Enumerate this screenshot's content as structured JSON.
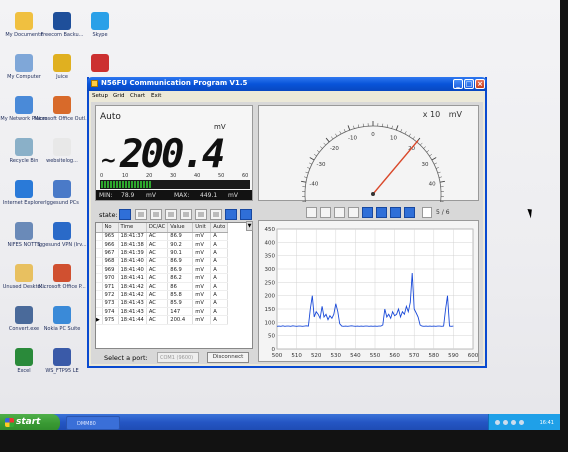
{
  "desktop": {
    "icons": [
      {
        "label": "My Documents",
        "color": "#f0c040"
      },
      {
        "label": "Freecom Backu...",
        "color": "#1e4f9a"
      },
      {
        "label": "Skype",
        "color": "#2aa0e8"
      },
      {
        "label": "My Computer",
        "color": "#7fa7d8"
      },
      {
        "label": "Juice",
        "color": "#e0b020"
      },
      {
        "label": "",
        "color": "#cc3030"
      },
      {
        "label": "My Network Places",
        "color": "#4a8ad8"
      },
      {
        "label": "Microsoft Office Outl...",
        "color": "#d86a2a"
      },
      {
        "label": "Recycle Bin",
        "color": "#8ab0c8"
      },
      {
        "label": "websitelog...",
        "color": "#e8e8e8"
      },
      {
        "label": "Internet Explorer",
        "color": "#2a7ad8"
      },
      {
        "label": "Iggesund PCs",
        "color": "#4a7ac8"
      },
      {
        "label": "NIFES NOTTS",
        "color": "#6a8ab8"
      },
      {
        "label": "Iggesund VPN (Irv...",
        "color": "#2a6ac8"
      },
      {
        "label": "Unused Deskto...",
        "color": "#e8c060"
      },
      {
        "label": "Microsoft Office P...",
        "color": "#d05030"
      },
      {
        "label": "Convert.exe",
        "color": "#4a6a9a"
      },
      {
        "label": "Nokia PC Suite",
        "color": "#3a8ad8"
      },
      {
        "label": "Excel",
        "color": "#2a8a3a"
      },
      {
        "label": "WS_FTP95 LE",
        "color": "#3a5aa8"
      }
    ]
  },
  "taskbar": {
    "start_label": "start",
    "task_label": "DMM80",
    "clock": "16:41"
  },
  "window": {
    "title": "N56FU Communication Program V1.5",
    "controls": {
      "minimize": "_",
      "maximize": "□",
      "close": "×"
    },
    "menu": [
      "Setup",
      "Grid",
      "Chart",
      "Exit"
    ]
  },
  "meter": {
    "mode": "Auto",
    "unit": "mV",
    "ac_symbol": "~",
    "reading": "200.4",
    "scale_ticks": [
      "0",
      "10",
      "20",
      "30",
      "40",
      "50",
      "60"
    ],
    "bar_fraction": 0.34,
    "min_label": "MIN:",
    "min_value": "78.9",
    "min_unit": "mV",
    "max_label": "MAX:",
    "max_value": "449.1",
    "max_unit": "mV"
  },
  "state_label": "state:",
  "table": {
    "headers": [
      "",
      "No",
      "Time",
      "DC/AC",
      "Value",
      "Unit",
      "Auto"
    ],
    "rows": [
      [
        "965",
        "18:41:37",
        "AC",
        "86.9",
        "mV",
        "A"
      ],
      [
        "966",
        "18:41:38",
        "AC",
        "90.2",
        "mV",
        "A"
      ],
      [
        "967",
        "18:41:39",
        "AC",
        "90.1",
        "mV",
        "A"
      ],
      [
        "968",
        "18:41:40",
        "AC",
        "86.9",
        "mV",
        "A"
      ],
      [
        "969",
        "18:41:40",
        "AC",
        "86.9",
        "mV",
        "A"
      ],
      [
        "970",
        "18:41:41",
        "AC",
        "86.2",
        "mV",
        "A"
      ],
      [
        "971",
        "18:41:42",
        "AC",
        "86",
        "mV",
        "A"
      ],
      [
        "972",
        "18:41:42",
        "AC",
        "85.8",
        "mV",
        "A"
      ],
      [
        "973",
        "18:41:43",
        "AC",
        "85.9",
        "mV",
        "A"
      ],
      [
        "974",
        "18:41:43",
        "AC",
        "147",
        "mV",
        "A"
      ],
      [
        "975",
        "18:41:44",
        "AC",
        "200.4",
        "mV",
        "A"
      ]
    ],
    "current_row_index": 10
  },
  "port": {
    "label": "Select a port:",
    "selected": "COM1 (9600)",
    "disconnect_label": "Disconnect"
  },
  "gauge": {
    "range_multiplier": "x 10",
    "unit": "mV",
    "ticks": [
      "-60",
      "-50",
      "-40",
      "-30",
      "-20",
      "-10",
      "0",
      "10",
      "20",
      "30",
      "40",
      "50",
      "60"
    ],
    "value": 20.04,
    "min": -60,
    "max": 60
  },
  "chart_toolbar": {
    "page_current": "5",
    "page_total": "6",
    "page_sep": "/"
  },
  "chart_data": {
    "type": "line",
    "title": "",
    "xlabel": "",
    "ylabel": "",
    "xlim": [
      500,
      600
    ],
    "ylim": [
      0,
      450
    ],
    "x_ticks": [
      500,
      510,
      520,
      530,
      540,
      550,
      560,
      570,
      580,
      590,
      600
    ],
    "y_ticks": [
      0,
      50,
      100,
      150,
      200,
      250,
      300,
      350,
      400,
      450
    ],
    "grid": true,
    "series": [
      {
        "color": "#1a4ad8",
        "x": [
          500,
          501,
          502,
          503,
          504,
          505,
          506,
          507,
          508,
          509,
          510,
          511,
          512,
          513,
          514,
          515,
          516,
          517,
          518,
          519,
          520,
          521,
          522,
          523,
          524,
          525,
          526,
          527,
          528,
          529,
          530,
          531,
          532,
          533,
          534,
          535,
          536,
          537,
          538,
          539,
          540,
          541,
          542,
          543,
          544,
          545,
          546,
          547,
          548,
          549,
          550,
          551,
          552,
          553,
          554,
          555,
          556,
          557,
          558,
          559,
          560,
          561,
          562,
          563,
          564,
          565,
          566,
          567,
          568,
          569,
          570,
          571,
          572,
          573,
          574,
          575,
          576,
          577,
          578,
          579,
          580,
          581,
          582,
          583,
          584,
          585,
          586,
          587,
          588,
          589,
          590
        ],
        "y": [
          85,
          86,
          85,
          87,
          85,
          86,
          86,
          85,
          87,
          86,
          85,
          86,
          86,
          85,
          86,
          87,
          86,
          150,
          200,
          120,
          140,
          130,
          115,
          160,
          120,
          130,
          110,
          125,
          115,
          130,
          170,
          140,
          95,
          86,
          85,
          86,
          85,
          86,
          87,
          86,
          85,
          86,
          85,
          86,
          85,
          86,
          86,
          85,
          86,
          85,
          86,
          85,
          86,
          86,
          90,
          150,
          120,
          130,
          115,
          140,
          125,
          130,
          150,
          120,
          140,
          130,
          160,
          140,
          175,
          285,
          150,
          135,
          120,
          90,
          86,
          85,
          86,
          85,
          86,
          85,
          86,
          85,
          86,
          86,
          85,
          86,
          150,
          200,
          86,
          85,
          86
        ]
      }
    ]
  }
}
